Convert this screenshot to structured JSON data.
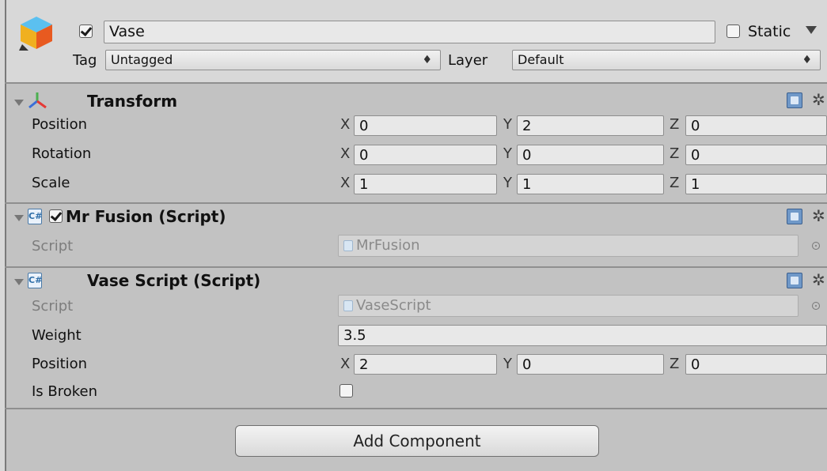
{
  "object": {
    "name": "Vase",
    "active": true,
    "static_label": "Static",
    "static_checked": false,
    "tag_label": "Tag",
    "tag_value": "Untagged",
    "layer_label": "Layer",
    "layer_value": "Default"
  },
  "transform": {
    "title": "Transform",
    "rows": [
      {
        "label": "Position",
        "x": "0",
        "y": "2",
        "z": "0"
      },
      {
        "label": "Rotation",
        "x": "0",
        "y": "0",
        "z": "0"
      },
      {
        "label": "Scale",
        "x": "1",
        "y": "1",
        "z": "1"
      }
    ]
  },
  "axes": {
    "x": "X",
    "y": "Y",
    "z": "Z"
  },
  "mr_fusion": {
    "title": "Mr Fusion (Script)",
    "enabled": true,
    "script_label": "Script",
    "script_value": "MrFusion"
  },
  "vase_script": {
    "title": "Vase Script (Script)",
    "script_label": "Script",
    "script_value": "VaseScript",
    "weight_label": "Weight",
    "weight_value": "3.5",
    "position_label": "Position",
    "position": {
      "x": "2",
      "y": "0",
      "z": "0"
    },
    "is_broken_label": "Is Broken",
    "is_broken": false
  },
  "add_component_label": "Add Component",
  "icons": {
    "object": "cube-icon",
    "transform": "axes-icon",
    "help": "help-book-icon",
    "settings": "gear-icon",
    "script": "csharp-script-icon",
    "object_picker": "object-picker-icon"
  },
  "colors": {
    "panel_bg": "#c2c2c2",
    "header_bg": "#d8d8d8",
    "field_bg": "#e8e8e8"
  }
}
